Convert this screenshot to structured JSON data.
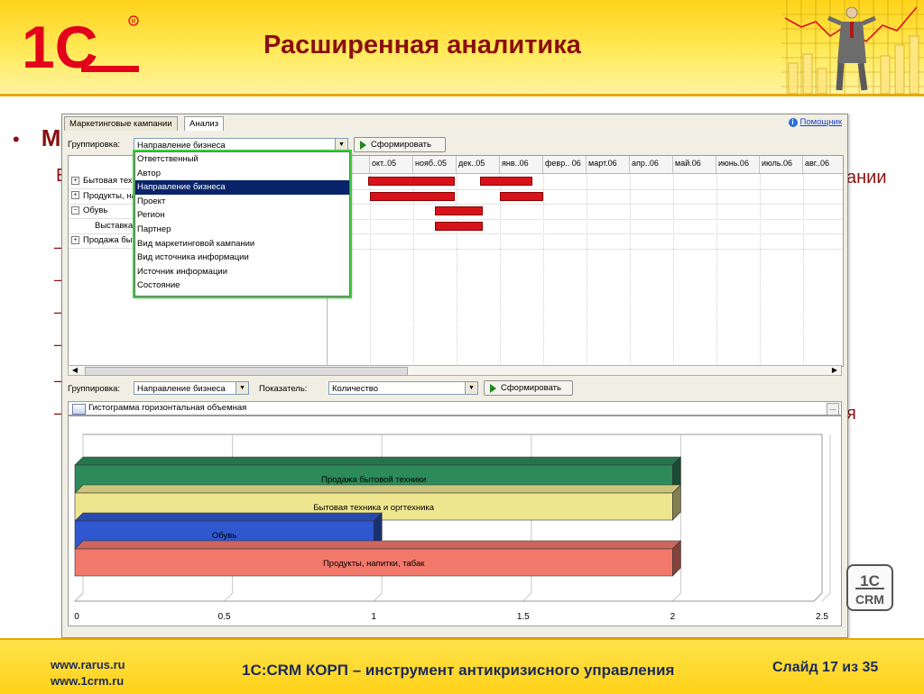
{
  "slide": {
    "title": "Расширенная аналитика",
    "bullet_visible": "М",
    "partial_texts": [
      {
        "text": "В",
        "key": "b1"
      },
      {
        "text": "ании",
        "key": "b2"
      },
      {
        "text": "я",
        "key": "b3"
      }
    ],
    "dashes": [
      "–",
      "–",
      "–",
      "–",
      "–",
      "–"
    ]
  },
  "window": {
    "tabs": [
      "Маркетинговые кампании",
      "Анализ"
    ],
    "active_tab": "Анализ",
    "help_label": "Помощник",
    "top_toolbar": {
      "grouping_label": "Группировка:",
      "grouping_value": "Направление бизнеса",
      "generate_label": "Сформировать"
    },
    "grouping_options": [
      "Ответственный",
      "Автор",
      "Направление бизнеса",
      "Проект",
      "Регион",
      "Партнер",
      "Вид маркетинговой кампании",
      "Вид источника информации",
      "Источник информации",
      "Состояние"
    ],
    "selected_option_index": 2,
    "tree_rows": [
      {
        "sign": "+",
        "label": "Бытовая техника и оргтехника",
        "indent": 0
      },
      {
        "sign": "+",
        "label": "Продукты, напитки, табак",
        "indent": 0
      },
      {
        "sign": "−",
        "label": "Обувь",
        "indent": 0
      },
      {
        "sign": "",
        "label": "Выставка",
        "indent": 1
      },
      {
        "sign": "+",
        "label": "Продажа бытовой техники",
        "indent": 0
      }
    ],
    "months": [
      "...05",
      "окт..05",
      "нояб..05",
      "дек..05",
      "янв..06",
      "февр.. 06",
      "март.06",
      "апр..06",
      "май.06",
      "июнь.06",
      "июль.06",
      "авг..06"
    ],
    "gantt": [
      {
        "row": 0,
        "from": 0.95,
        "to": 2.95
      },
      {
        "row": 0,
        "from": 3.55,
        "to": 4.75
      },
      {
        "row": 1,
        "from": 1.0,
        "to": 2.95
      },
      {
        "row": 1,
        "from": 4.0,
        "to": 5.0
      },
      {
        "row": 2,
        "from": 2.5,
        "to": 3.6
      },
      {
        "row": 3,
        "from": 2.5,
        "to": 3.6
      }
    ],
    "bottom_toolbar": {
      "grouping_label": "Группировка:",
      "grouping_value": "Направление бизнеса",
      "indicator_label": "Показатель:",
      "indicator_value": "Количество",
      "generate_label": "Сформировать"
    },
    "chart_title": "Гистограмма горизонтальная объемная"
  },
  "chart_data": {
    "type": "bar",
    "orientation": "horizontal",
    "title": "Гистограмма горизонтальная объемная",
    "categories": [
      "Продажа бытовой техники",
      "Бытовая техника и оргтехника",
      "Обувь",
      "Продукты, напитки, табак"
    ],
    "values": [
      2,
      2,
      1,
      2
    ],
    "colors": [
      "#2d8a5a",
      "#efe690",
      "#2f57cf",
      "#f2786c"
    ],
    "xlim": [
      0,
      2.5
    ],
    "xticks": [
      "0",
      "0.5",
      "1",
      "1.5",
      "2",
      "2.5"
    ],
    "grid": true
  },
  "footer": {
    "url1": "www.rarus.ru",
    "url2": "www.1crm.ru",
    "title": "1С:CRM КОРП – инструмент антикризисного управления",
    "slide_num": "Слайд 17 из 35"
  },
  "brand": {
    "logo_text": "1С",
    "badge_text": "CRM"
  }
}
